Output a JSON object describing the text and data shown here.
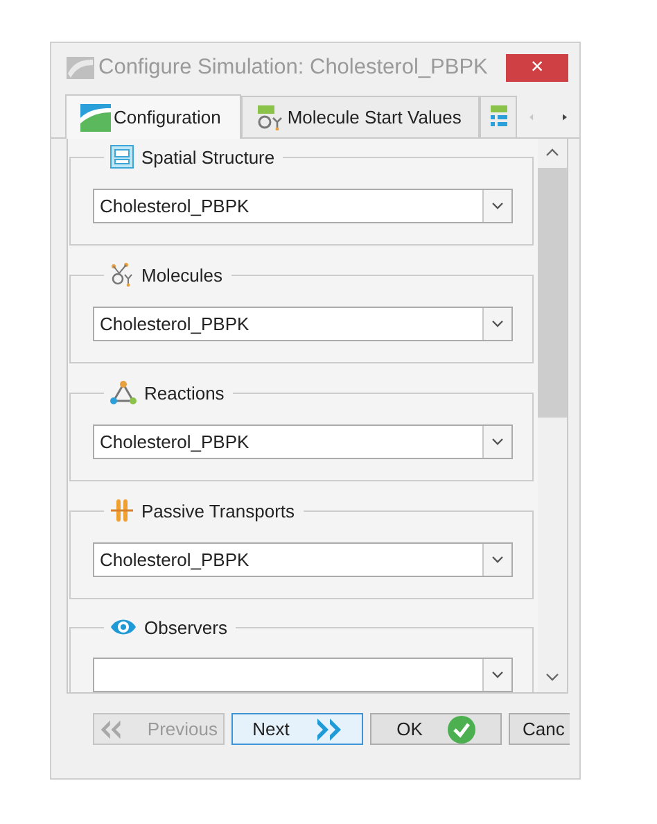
{
  "window": {
    "title": "Configure Simulation: Cholesterol_PBPK",
    "close": "×"
  },
  "tabs": [
    {
      "label": "Configuration",
      "selected": true,
      "kind": "configuration"
    },
    {
      "label": "Molecule Start Values",
      "selected": false,
      "kind": "molecules"
    },
    {
      "selected": false,
      "kind": "list"
    }
  ],
  "groups": [
    {
      "title": "Spatial Structure",
      "kind": "structure",
      "value": "Cholesterol_PBPK"
    },
    {
      "title": "Molecules",
      "kind": "molecules",
      "value": "Cholesterol_PBPK"
    },
    {
      "title": "Reactions",
      "kind": "reactions",
      "value": "Cholesterol_PBPK"
    },
    {
      "title": "Passive Transports",
      "kind": "transports",
      "value": "Cholesterol_PBPK"
    },
    {
      "title": "Observers",
      "kind": "observers"
    }
  ],
  "buttons": [
    {
      "label": "Previous",
      "kind": "previous",
      "disabled": true,
      "focused": false
    },
    {
      "label": "Next",
      "kind": "next",
      "disabled": false,
      "focused": true
    },
    {
      "label": "OK",
      "kind": "ok",
      "disabled": false,
      "focused": false
    },
    {
      "label": "Canc",
      "kind": "plain",
      "disabled": false,
      "focused": false
    }
  ]
}
